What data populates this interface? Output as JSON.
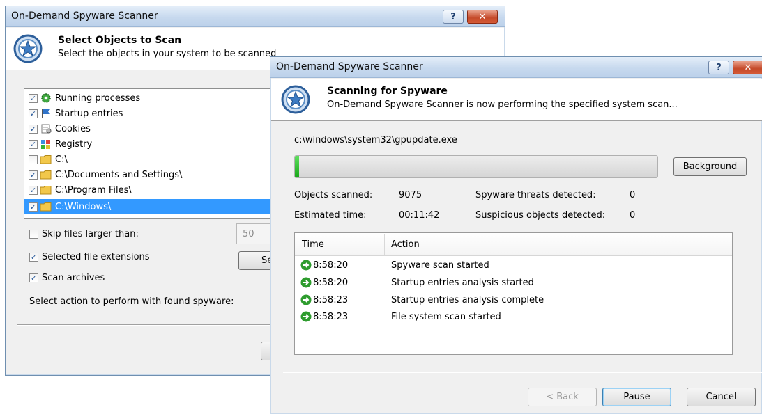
{
  "back_window": {
    "title": "On-Demand Spyware Scanner",
    "header_title": "Select Objects to Scan",
    "header_subtitle": "Select the objects in your system to be scanned",
    "objects": [
      {
        "label": "Running processes",
        "checked": true,
        "icon": "gear-icon"
      },
      {
        "label": "Startup entries",
        "checked": true,
        "icon": "flag-icon"
      },
      {
        "label": "Cookies",
        "checked": true,
        "icon": "cookie-icon"
      },
      {
        "label": "Registry",
        "checked": true,
        "icon": "registry-icon"
      },
      {
        "label": "C:\\",
        "checked": false,
        "icon": "folder-icon"
      },
      {
        "label": "C:\\Documents and Settings\\",
        "checked": true,
        "icon": "folder-icon"
      },
      {
        "label": "C:\\Program Files\\",
        "checked": true,
        "icon": "folder-icon"
      },
      {
        "label": "C:\\Windows\\",
        "checked": true,
        "icon": "folder-icon",
        "selected": true
      }
    ],
    "skip_files_label": "Skip files larger than:",
    "skip_files_checked": false,
    "skip_files_value": "50",
    "selected_ext_label": "Selected file extensions",
    "selected_ext_checked": true,
    "select_button_label": "Se",
    "scan_archives_label": "Scan archives",
    "scan_archives_checked": true,
    "action_label": "Select action to perform with found spyware:"
  },
  "front_window": {
    "title": "On-Demand Spyware Scanner",
    "header_title": "Scanning for Spyware",
    "header_subtitle": "On-Demand Spyware Scanner is now performing the specified system scan...",
    "current_file": "c:\\windows\\system32\\gpupdate.exe",
    "progress_fraction": 0.012,
    "background_button": "Background",
    "objects_scanned_label": "Objects scanned:",
    "objects_scanned_value": "9075",
    "estimated_time_label": "Estimated time:",
    "estimated_time_value": "00:11:42",
    "threats_label": "Spyware threats detected:",
    "threats_value": "0",
    "suspicious_label": "Suspicious objects detected:",
    "suspicious_value": "0",
    "log_columns": {
      "time": "Time",
      "action": "Action"
    },
    "log_rows": [
      {
        "time": "8:58:20",
        "action": "Spyware scan started"
      },
      {
        "time": "8:58:20",
        "action": "Startup entries analysis started"
      },
      {
        "time": "8:58:23",
        "action": "Startup entries analysis complete"
      },
      {
        "time": "8:58:23",
        "action": "File system scan started"
      }
    ],
    "back_button": "< Back",
    "pause_button": "Pause",
    "cancel_button": "Cancel"
  },
  "title_buttons": {
    "help": "?",
    "close": "✕"
  },
  "colors": {
    "accent": "#3399ff",
    "progress": "#19a619",
    "ok": "#2e9c2e"
  }
}
